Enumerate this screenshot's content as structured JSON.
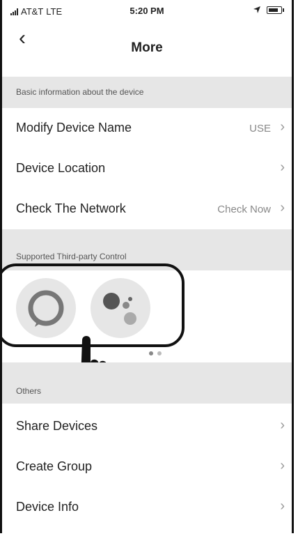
{
  "status_bar": {
    "carrier": "AT&T",
    "network": "LTE",
    "time": "5:20 PM"
  },
  "nav": {
    "back_icon": "chevron-left-icon",
    "title": "More"
  },
  "section_basic": {
    "title": "Basic information about the device"
  },
  "basic_items": [
    {
      "label": "Modify Device Name",
      "value": "USE"
    },
    {
      "label": "Device Location",
      "value": ""
    },
    {
      "label": "Check The Network",
      "value": "Check Now"
    }
  ],
  "section_third_party": {
    "title": "Supported Third-party Control"
  },
  "third_party": [
    {
      "icon": "alexa-icon"
    },
    {
      "icon": "google-assistant-icon"
    }
  ],
  "carousel": {
    "pages": 2,
    "current": 1
  },
  "section_others": {
    "title": "Others"
  },
  "other_items": [
    {
      "label": "Share Devices"
    },
    {
      "label": "Create Group"
    },
    {
      "label": "Device Info"
    }
  ],
  "colors": {
    "section_bg": "#e6e6e6",
    "text": "#222222",
    "secondary": "#888888"
  }
}
